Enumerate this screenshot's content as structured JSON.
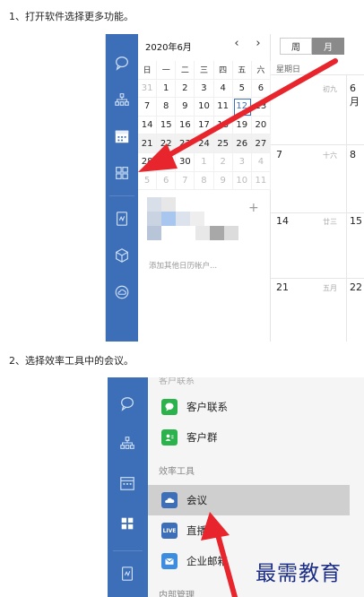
{
  "step1": {
    "text": "1、打开软件选择更多功能。"
  },
  "step2": {
    "text": "2、选择效率工具中的会议。"
  },
  "shot1": {
    "mini_calendar": {
      "month_label": "2020年6月",
      "prev": "‹",
      "next": "›",
      "weekdays": [
        "日",
        "一",
        "二",
        "三",
        "四",
        "五",
        "六"
      ],
      "weeks": [
        [
          "31",
          "1",
          "2",
          "3",
          "4",
          "5",
          "6"
        ],
        [
          "7",
          "8",
          "9",
          "10",
          "11",
          "12",
          "13"
        ],
        [
          "14",
          "15",
          "16",
          "17",
          "18",
          "19",
          "20"
        ],
        [
          "21",
          "22",
          "23",
          "24",
          "25",
          "26",
          "27"
        ],
        [
          "28",
          "29",
          "30",
          "1",
          "2",
          "3",
          "4"
        ],
        [
          "5",
          "6",
          "7",
          "8",
          "9",
          "10",
          "11"
        ]
      ],
      "today": "12"
    },
    "accounts": {
      "add_icon": "plus-icon",
      "add_link": "添加其他日历帐户..."
    },
    "view_switch": {
      "week": "周",
      "month": "月"
    },
    "main_calendar": {
      "col_header": "星期日",
      "rows": [
        {
          "date": "",
          "lunar": "初九",
          "next_date": "6月"
        },
        {
          "date": "7",
          "lunar": "十六",
          "next_date": "8"
        },
        {
          "date": "14",
          "lunar": "廿三",
          "next_date": "15"
        },
        {
          "date": "21",
          "lunar": "五月",
          "next_date": "22"
        }
      ]
    },
    "rail_icons": [
      "chat-icon",
      "org-icon",
      "calendar-icon",
      "apps-grid-icon",
      "doc-icon",
      "cube-icon",
      "cloud-icon"
    ]
  },
  "shot2": {
    "top_partial": "客户联系",
    "items_top": [
      {
        "label": "客户联系",
        "icon": "wechat-icon",
        "color": "#2bb24c"
      },
      {
        "label": "客户群",
        "icon": "contact-group-icon",
        "color": "#2bb24c"
      }
    ],
    "section_title": "效率工具",
    "items_tools": [
      {
        "label": "会议",
        "icon": "meeting-icon",
        "color": "#3d6fb9"
      },
      {
        "label": "直播",
        "icon": "live-icon",
        "color": "#3d6fb9",
        "badge": "LIVE"
      },
      {
        "label": "企业邮箱",
        "icon": "mail-icon",
        "color": "#3d8ce0"
      }
    ],
    "section_bottom": "内部管理",
    "rail_icons": [
      "chat-icon",
      "org-icon",
      "calendar-icon",
      "apps-grid-icon",
      "doc-icon"
    ]
  },
  "watermark": "最需教育",
  "colors": {
    "brand": "#3d6fb9",
    "arrow": "#e8242c",
    "active_row": "#cfcfcf"
  }
}
